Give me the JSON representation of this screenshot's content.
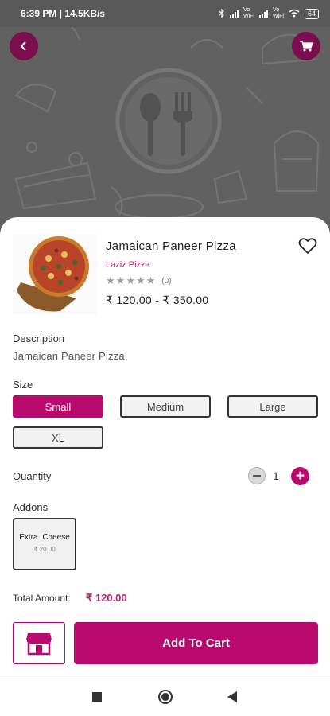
{
  "status_bar": {
    "time_speed": "6:39 PM | 14.5KB/s",
    "net1": "Vo\nWiFi",
    "net2": "Vo\nWiFi",
    "battery": "64"
  },
  "product": {
    "name": "Jamaican Paneer Pizza",
    "store": "Laziz Pizza",
    "rating": 0,
    "review_count": "(0)",
    "price_range": "₹ 120.00 - ₹ 350.00"
  },
  "description": {
    "label": "Description",
    "text": "Jamaican Paneer Pizza"
  },
  "size": {
    "label": "Size",
    "options": [
      {
        "label": "Small",
        "selected": true
      },
      {
        "label": "Medium",
        "selected": false
      },
      {
        "label": "Large",
        "selected": false
      },
      {
        "label": "XL",
        "selected": false
      }
    ]
  },
  "quantity": {
    "label": "Quantity",
    "value": "1",
    "plus": "+"
  },
  "addons": {
    "label": "Addons",
    "items": [
      {
        "name": "Extra Cheese",
        "price": "₹ 20.00"
      }
    ]
  },
  "total": {
    "label": "Total Amount:",
    "value": "₹ 120.00"
  },
  "actions": {
    "add_to_cart": "Add To Cart"
  },
  "icons": {
    "back": "chevron-left-icon",
    "cart": "shopping-cart-icon",
    "heart": "heart-outline-icon",
    "store": "store-icon",
    "hero": "spoon-fork-plate-icon"
  },
  "colors": {
    "accent": "#b8096d",
    "accent_dark": "#7b0f4d",
    "hero_bg": "#616161",
    "store_text": "#b5206f"
  }
}
